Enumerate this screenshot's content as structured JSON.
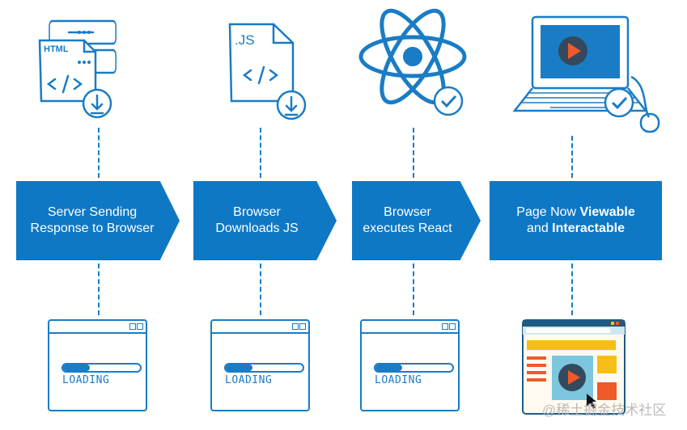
{
  "colors": {
    "accent": "#0f78c4",
    "icon_blue": "#1a7cc5",
    "orange": "#f05a28",
    "yellow": "#f6be16",
    "dark": "#34495e"
  },
  "steps": [
    {
      "line1": "Server Sending",
      "line2": "Response to Browser",
      "icon": "html-file-server-download-icon"
    },
    {
      "line1": "Browser",
      "line2": "Downloads JS",
      "icon": "js-file-download-icon"
    },
    {
      "line1": "Browser",
      "line2": "executes React",
      "icon": "react-check-icon"
    },
    {
      "line1_pre": "Page Now ",
      "line1_bold": "Viewable",
      "line2_pre": "and ",
      "line2_bold": "Interactable",
      "icon": "laptop-check-icon"
    }
  ],
  "icons": {
    "html_label": "HTML",
    "js_label": ".JS"
  },
  "loading": {
    "label": "LOADING",
    "progress": [
      0.35,
      0.35,
      0.35
    ]
  },
  "watermark": "@稀土掘金技术社区"
}
